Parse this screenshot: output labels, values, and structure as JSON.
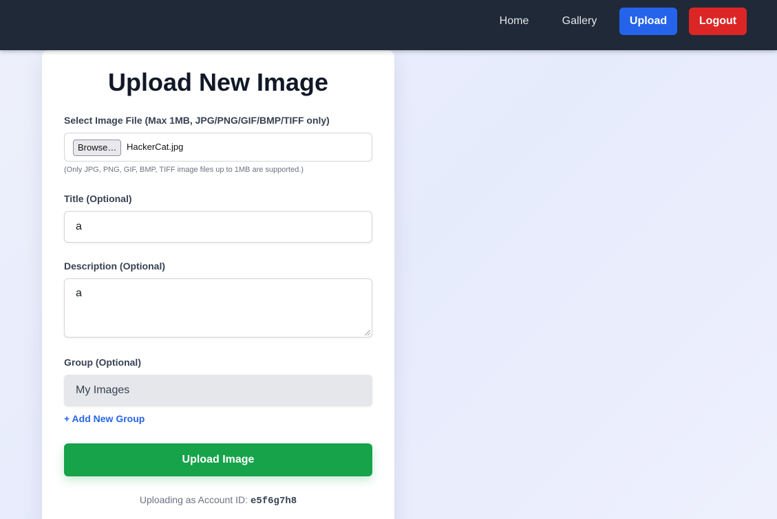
{
  "nav": {
    "home": "Home",
    "gallery": "Gallery",
    "upload": "Upload",
    "logout": "Logout"
  },
  "form": {
    "title": "Upload New Image",
    "file_label": "Select Image File (Max 1MB, JPG/PNG/GIF/BMP/TIFF only)",
    "browse_label": "Browse…",
    "file_name": "HackerCat.jpg",
    "file_help": "(Only JPG, PNG, GIF, BMP, TIFF image files up to 1MB are supported.)",
    "title_label": "Title (Optional)",
    "title_value": "a",
    "description_label": "Description (Optional)",
    "description_value": "a",
    "group_label": "Group (Optional)",
    "group_value": "My Images",
    "add_group_label": "+ Add New Group",
    "submit_label": "Upload Image",
    "account_prefix": "Uploading as Account ID: ",
    "account_id": "e5f6g7h8"
  },
  "colors": {
    "navbar": "#1f2937",
    "upload_button": "#2563eb",
    "logout_button": "#dc2626",
    "submit_button": "#16a34a",
    "link": "#2563eb"
  }
}
